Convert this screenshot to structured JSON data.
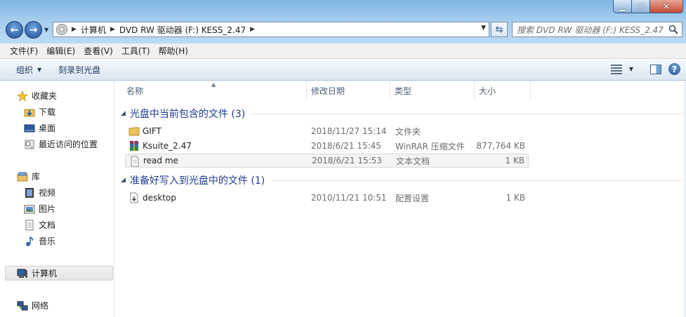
{
  "window": {
    "controls": {
      "minimize": "▁",
      "maximize": "▢",
      "close": "✕"
    }
  },
  "address": {
    "crumbs": [
      "计算机",
      "DVD RW 驱动器 (F:) KESS_2.47"
    ],
    "search_placeholder": "搜索 DVD RW 驱动器 (F:) KESS_2.47"
  },
  "menu": [
    "文件(F)",
    "编辑(E)",
    "查看(V)",
    "工具(T)",
    "帮助(H)"
  ],
  "toolbar": {
    "organize": "组织",
    "burn": "刻录到光盘"
  },
  "nav": {
    "favorites": "收藏夹",
    "downloads": "下载",
    "desktop": "桌面",
    "recent": "最近访问的位置",
    "libraries": "库",
    "videos": "视频",
    "pictures": "图片",
    "documents": "文档",
    "music": "音乐",
    "computer": "计算机",
    "network": "网络"
  },
  "columns": {
    "name": "名称",
    "date": "修改日期",
    "type": "类型",
    "size": "大小"
  },
  "groups": [
    {
      "title": "光盘中当前包含的文件 (3)",
      "files": [
        {
          "name": "GIFT",
          "date": "2018/11/27 15:14",
          "type": "文件夹",
          "size": "",
          "icon": "folder-icon"
        },
        {
          "name": "Ksuite_2.47",
          "date": "2018/6/21 15:45",
          "type": "WinRAR 压缩文件",
          "size": "877,764 KB",
          "icon": "winrar-icon"
        },
        {
          "name": "read me",
          "date": "2018/6/21 15:53",
          "type": "文本文档",
          "size": "1 KB",
          "icon": "text-file-icon"
        }
      ]
    },
    {
      "title": "准备好写入到光盘中的文件 (1)",
      "files": [
        {
          "name": "desktop",
          "date": "2010/11/21 10:51",
          "type": "配置设置",
          "size": "1 KB",
          "icon": "config-file-icon"
        }
      ]
    }
  ]
}
